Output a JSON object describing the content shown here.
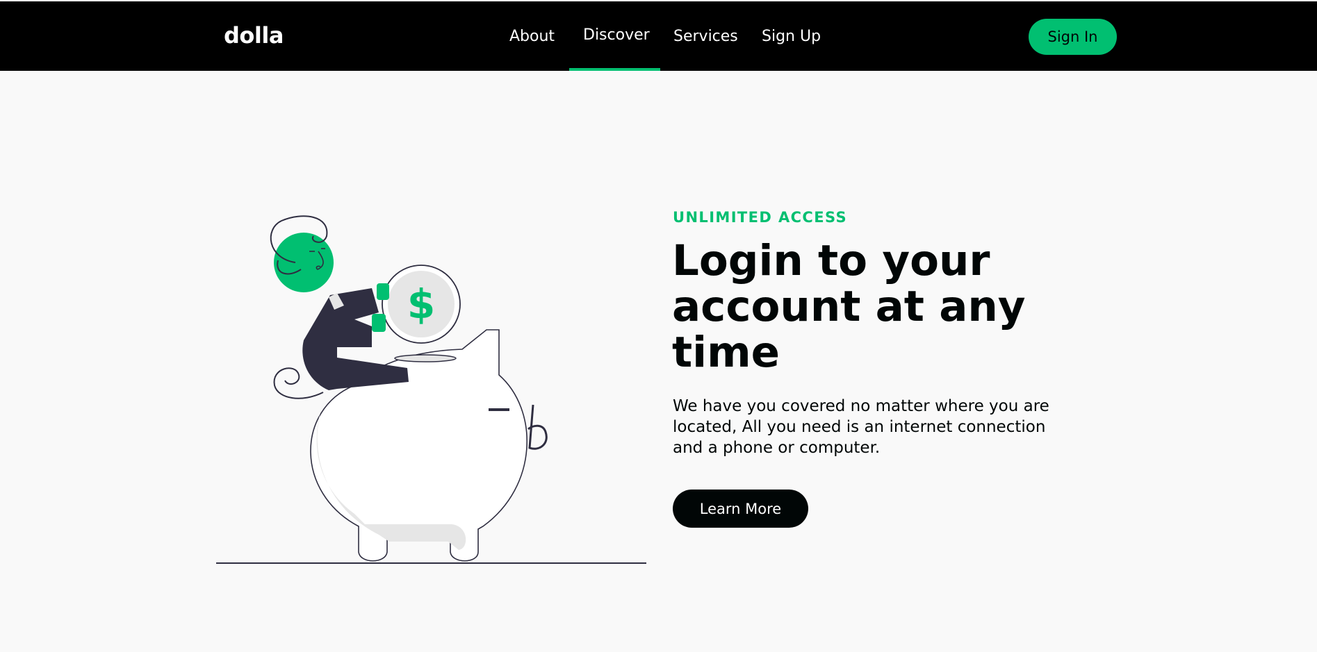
{
  "navbar": {
    "logo": "dolla",
    "links": [
      "About",
      "Discover",
      "Services",
      "Sign Up"
    ],
    "active_link": "Discover",
    "signin_label": "Sign In"
  },
  "hero": {
    "topline": "UNLIMITED ACCESS",
    "heading": "Login to your account at any time",
    "description": "We have you covered no matter where you are located, All you need is an internet connection and a phone or computer.",
    "button_label": "Learn More",
    "illustration_icon": "piggy-bank-with-person-and-coin-illustration"
  },
  "colors": {
    "accent": "#01bf71",
    "nav_background": "#000000",
    "page_background": "#f9f9f9",
    "text_dark": "#010606"
  }
}
